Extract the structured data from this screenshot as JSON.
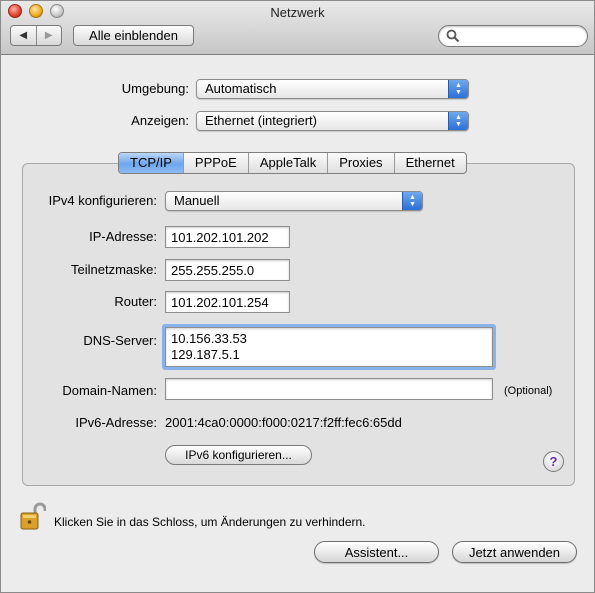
{
  "window": {
    "title": "Netzwerk"
  },
  "toolbar": {
    "back_icon": "◀",
    "forward_icon": "▶",
    "show_all_label": "Alle einblenden",
    "search_placeholder": ""
  },
  "location": {
    "label": "Umgebung:",
    "value": "Automatisch"
  },
  "show": {
    "label": "Anzeigen:",
    "value": "Ethernet (integriert)"
  },
  "tabs": [
    {
      "label": "TCP/IP",
      "active": true
    },
    {
      "label": "PPPoE",
      "active": false
    },
    {
      "label": "AppleTalk",
      "active": false
    },
    {
      "label": "Proxies",
      "active": false
    },
    {
      "label": "Ethernet",
      "active": false
    }
  ],
  "tcpip": {
    "ipv4_config_label": "IPv4 konfigurieren:",
    "ipv4_config_value": "Manuell",
    "ip_label": "IP-Adresse:",
    "ip_value": "101.202.101.202",
    "subnet_label": "Teilnetzmaske:",
    "subnet_value": "255.255.255.0",
    "router_label": "Router:",
    "router_value": "101.202.101.254",
    "dns_label": "DNS-Server:",
    "dns_values": [
      "10.156.33.53",
      "129.187.5.1"
    ],
    "domain_label": "Domain-Namen:",
    "domain_value": "",
    "optional_note": "(Optional)",
    "ipv6_label": "IPv6-Adresse:",
    "ipv6_value": "2001:4ca0:0000:f000:0217:f2ff:fec6:65dd",
    "ipv6_config_button": "IPv6 konfigurieren...",
    "help_label": "?"
  },
  "footer": {
    "lock_text": "Klicken Sie in das Schloss, um Änderungen zu verhindern.",
    "assistant_button": "Assistent...",
    "apply_button": "Jetzt anwenden"
  },
  "colors": {
    "accent_blue": "#2a6fd6",
    "help_purple": "#6c2aa8",
    "lock_gold": "#d9a12b"
  }
}
